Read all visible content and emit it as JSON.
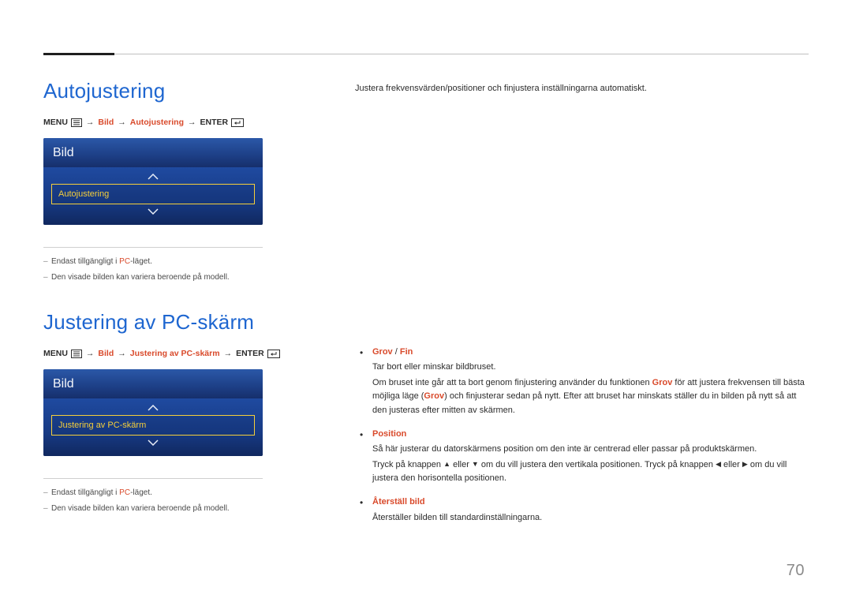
{
  "page_number": "70",
  "section1": {
    "heading": "Autojustering",
    "breadcrumb": {
      "menu": "MENU",
      "seg1": "Bild",
      "seg2": "Autojustering",
      "enter": "ENTER"
    },
    "panel": {
      "title": "Bild",
      "item": "Autojustering"
    },
    "notes": {
      "n1_pre": "Endast tillgängligt i ",
      "n1_mode": "PC",
      "n1_post": "-läget.",
      "n2": "Den visade bilden kan variera beroende på modell."
    }
  },
  "section2": {
    "heading": "Justering av PC-skärm",
    "breadcrumb": {
      "menu": "MENU",
      "seg1": "Bild",
      "seg2": "Justering av PC-skärm",
      "enter": "ENTER"
    },
    "panel": {
      "title": "Bild",
      "item": "Justering av PC-skärm"
    },
    "notes": {
      "n1_pre": "Endast tillgängligt i ",
      "n1_mode": "PC",
      "n1_post": "-läget.",
      "n2": "Den visade bilden kan variera beroende på modell."
    }
  },
  "right": {
    "intro": "Justera frekvensvärden/positioner och finjustera inställningarna automatiskt.",
    "items": [
      {
        "label1": "Grov",
        "sep": " / ",
        "label2": "Fin",
        "p1": "Tar bort eller minskar bildbruset.",
        "p2_a": "Om bruset inte går att ta bort genom finjustering använder du funktionen ",
        "p2_grov1": "Grov",
        "p2_b": " för att justera frekvensen till bästa möjliga läge (",
        "p2_grov2": "Grov",
        "p2_c": ") och finjusterar sedan på nytt. Efter att bruset har minskats ställer du in bilden på nytt så att den justeras efter mitten av skärmen."
      },
      {
        "label": "Position",
        "p1": "Så här justerar du datorskärmens position om den inte är centrerad eller passar på produktskärmen.",
        "p2_a": "Tryck på knappen ",
        "p2_b": " eller ",
        "p2_c": " om du vill justera den vertikala positionen. Tryck på knappen ",
        "p2_d": " eller ",
        "p2_e": " om du vill justera den horisontella positionen."
      },
      {
        "label": "Återställ bild",
        "p1": "Återställer bilden till standardinställningarna."
      }
    ]
  }
}
